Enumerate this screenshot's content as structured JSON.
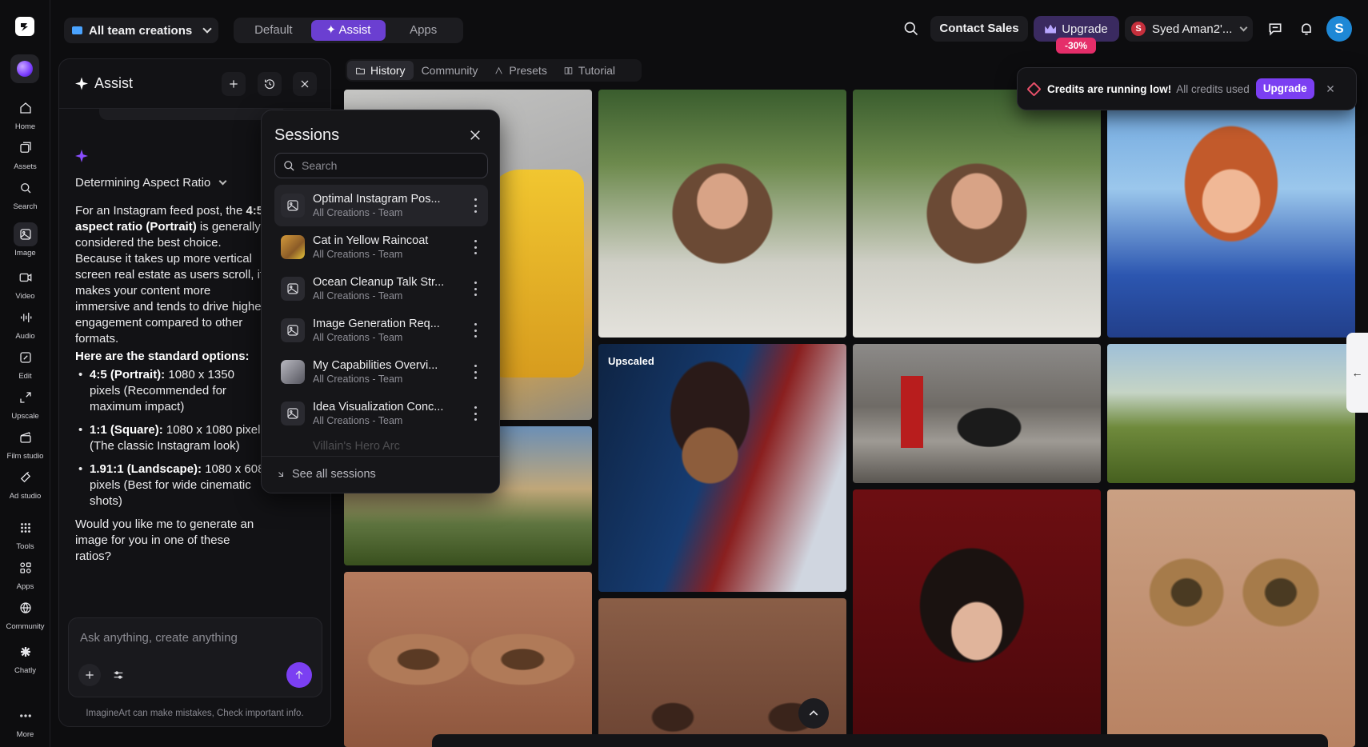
{
  "topbar": {
    "team_select": "All team creations",
    "modes": [
      "Default",
      "Assist",
      "Apps"
    ],
    "contact_sales": "Contact Sales",
    "upgrade": "Upgrade",
    "discount": "-30%",
    "user_name": "Syed Aman2'...",
    "user_initial": "S",
    "avatar_initial": "S"
  },
  "rail": {
    "items": [
      "Home",
      "Assets",
      "Search",
      "Image",
      "Video",
      "Audio",
      "Edit",
      "Upscale",
      "Film studio",
      "Ad studio",
      "Tools",
      "Apps",
      "Community",
      "Chatly",
      "More"
    ]
  },
  "assist": {
    "title": "Assist",
    "reasoning": "Determining Aspect Ratio",
    "intro_1": "For an Instagram feed post, the ",
    "intro_bold": "4:5 aspect ratio (Portrait)",
    "intro_2": " is generally considered the best choice. Because it takes up more vertical screen real estate as users scroll, it makes your content more immersive and tends to drive higher engagement compared to other formats.",
    "options_heading": "Here are the standard options:",
    "options": [
      {
        "bold": "4:5 (Portrait):",
        "text": " 1080 x 1350 pixels (Recommended for maximum impact)"
      },
      {
        "bold": "1:1 (Square):",
        "text": " 1080 x 1080 pixels (The classic Instagram look)"
      },
      {
        "bold": "1.91:1 (Landscape):",
        "text": " 1080 x 608 pixels (Best for wide cinematic shots)"
      }
    ],
    "question": "Would you like me to generate an image for you in one of these ratios?",
    "composer_placeholder": "Ask anything, create anything",
    "disclaimer": "ImagineArt can make mistakes, Check important info."
  },
  "sessions": {
    "title": "Sessions",
    "search_placeholder": "Search",
    "items": [
      {
        "title": "Optimal Instagram Pos...",
        "sub": "All Creations - Team",
        "thumb": "image-icon"
      },
      {
        "title": "Cat in Yellow Raincoat",
        "sub": "All Creations - Team",
        "thumb": "cat-thumbnail"
      },
      {
        "title": "Ocean Cleanup Talk Str...",
        "sub": "All Creations - Team",
        "thumb": "image-icon"
      },
      {
        "title": "Image Generation Req...",
        "sub": "All Creations - Team",
        "thumb": "image-icon"
      },
      {
        "title": "My Capabilities Overvi...",
        "sub": "All Creations - Team",
        "thumb": "robot-thumbnail"
      },
      {
        "title": "Idea Visualization Conc...",
        "sub": "All Creations - Team",
        "thumb": "image-icon"
      },
      {
        "title": "Villain's Hero Arc",
        "sub": "",
        "thumb": "image-icon"
      }
    ],
    "see_all": "See all sessions"
  },
  "gallery": {
    "tabs": [
      "History",
      "Community",
      "Presets",
      "Tutorial"
    ],
    "upscaled_label": "Upscaled"
  },
  "toast": {
    "title": "Credits are running low!",
    "subtitle": "All credits used",
    "button": "Upgrade"
  },
  "colors": {
    "accent": "#7b3ff2",
    "background": "#0d0d0f",
    "discount": "#e52e6a"
  }
}
